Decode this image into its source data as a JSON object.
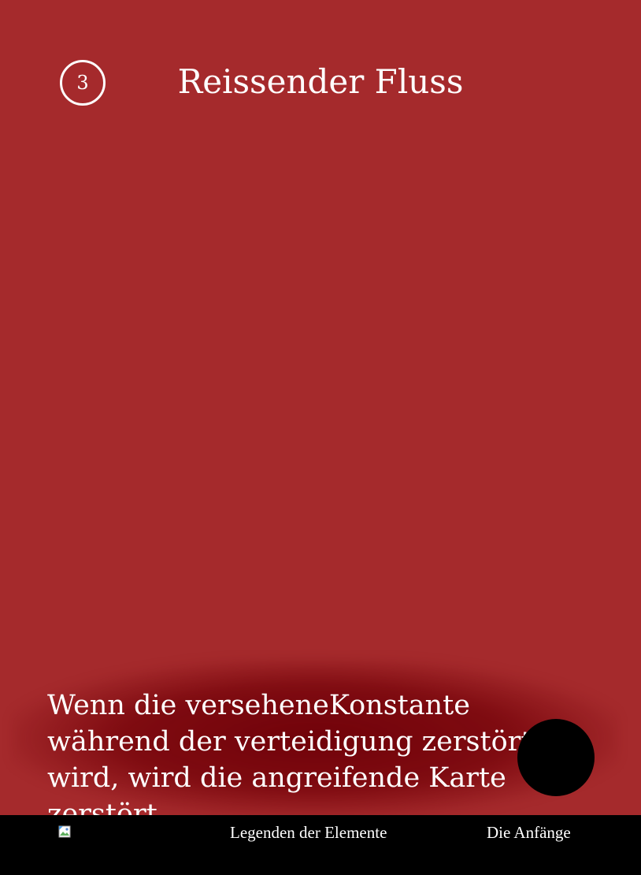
{
  "card": {
    "cost": "3",
    "title": "Reissender Fluss",
    "effect_text": "Wenn die verseheneKonstante während der verteidigung zerstört wird, wird die angreifende Karte zerstört.",
    "background_color": "#a52a2c",
    "element_orb_color": "#000000"
  },
  "footer": {
    "logo_icon": "broken-image-icon",
    "game_name": "Legenden der Elemente",
    "set_name": "Die Anfänge"
  }
}
